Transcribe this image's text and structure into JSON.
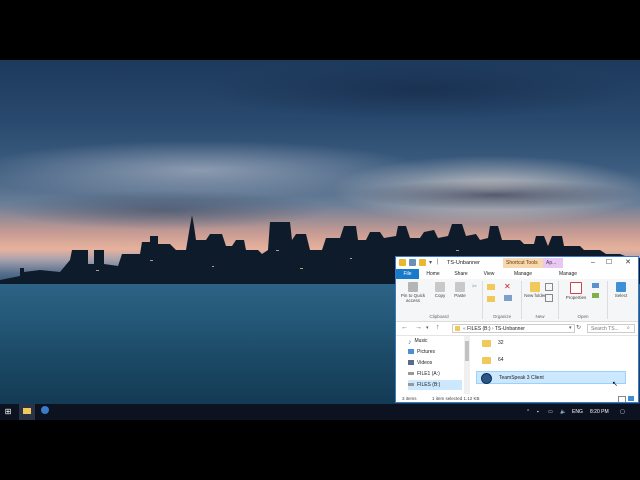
{
  "explorer": {
    "title": "TS-Unbanner",
    "context_tabs": [
      "Shortcut Tools",
      "Ap..."
    ],
    "ribbon_tabs": [
      "File",
      "Home",
      "Share",
      "View",
      "Manage",
      "Manage"
    ],
    "ribbon_buttons": {
      "pin": "Pin to Quick access",
      "copy": "Copy",
      "paste": "Paste",
      "new_folder": "New folder",
      "properties": "Properties",
      "select": "Select"
    },
    "ribbon_groups": [
      "Clipboard",
      "Organize",
      "New",
      "Open"
    ],
    "breadcrumb": [
      "FILES (B:)",
      "TS-Unbanner"
    ],
    "search_placeholder": "Search TS...",
    "nav_items": [
      "Music",
      "Pictures",
      "Videos",
      "FILE1 (A:)",
      "FILES (B:)"
    ],
    "files": [
      {
        "name": "32",
        "type": "folder"
      },
      {
        "name": "64",
        "type": "folder"
      },
      {
        "name": "TeamSpeak 3 Client",
        "type": "shortcut",
        "selected": true
      }
    ],
    "status": {
      "items": "3 items",
      "selected": "1 item selected  1.12 KB"
    }
  },
  "taskbar": {
    "language": "ENG",
    "time": "8:20 PM"
  },
  "colors": {
    "accent": "#1979ca",
    "selection": "#cce8ff",
    "taskbar": "#0c1220"
  }
}
